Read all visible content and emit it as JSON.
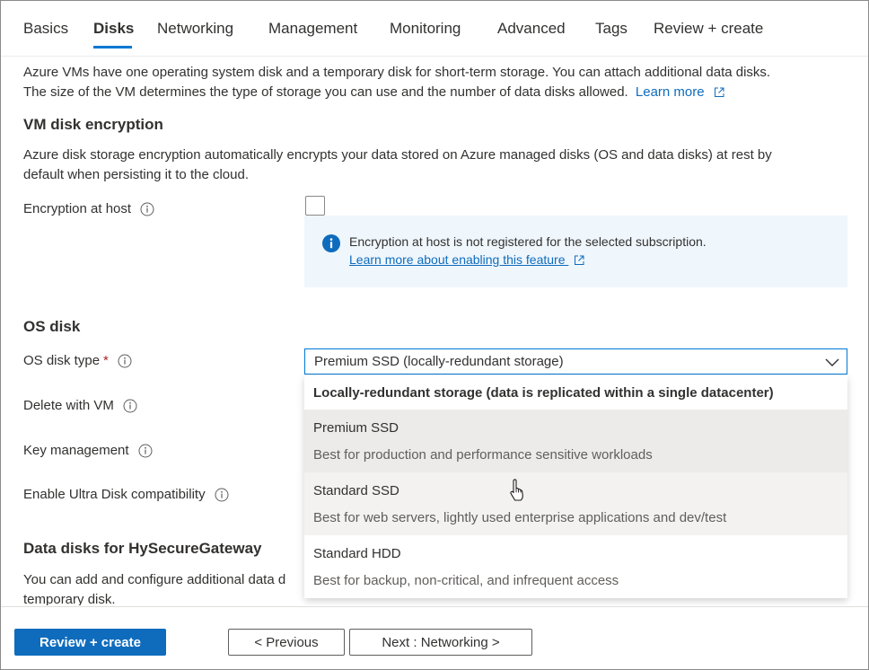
{
  "tabs": [
    {
      "label": "Basics",
      "active": false
    },
    {
      "label": "Disks",
      "active": true
    },
    {
      "label": "Networking",
      "active": false
    },
    {
      "label": "Management",
      "active": false
    },
    {
      "label": "Monitoring",
      "active": false
    },
    {
      "label": "Advanced",
      "active": false
    },
    {
      "label": "Tags",
      "active": false
    },
    {
      "label": "Review + create",
      "active": false
    }
  ],
  "intro": {
    "line1": "Azure VMs have one operating system disk and a temporary disk for short-term storage. You can attach additional data disks.",
    "line2": "The size of the VM determines the type of storage you can use and the number of data disks allowed.",
    "learn_more": "Learn more"
  },
  "encryption": {
    "heading": "VM disk encryption",
    "desc_line1": "Azure disk storage encryption automatically encrypts your data stored on Azure managed disks (OS and data disks) at rest by",
    "desc_line2": "default when persisting it to the cloud.",
    "host_label": "Encryption at host",
    "host_checked": false,
    "notice_text": "Encryption at host is not registered for the selected subscription.",
    "notice_link": "Learn more about enabling this feature"
  },
  "os_disk": {
    "heading": "OS disk",
    "type_label": "OS disk type",
    "required_mark": "*",
    "type_value": "Premium SSD (locally-redundant storage)",
    "delete_label": "Delete with VM",
    "key_label": "Key management",
    "ultra_label": "Enable Ultra Disk compatibility"
  },
  "dropdown": {
    "group_header": "Locally-redundant storage (data is replicated within a single datacenter)",
    "options": [
      {
        "title": "Premium SSD",
        "desc": "Best for production and performance sensitive workloads",
        "state": "selected"
      },
      {
        "title": "Standard SSD",
        "desc": "Best for web servers, lightly used enterprise applications and dev/test",
        "state": "hover"
      },
      {
        "title": "Standard HDD",
        "desc": "Best for backup, non-critical, and infrequent access",
        "state": "none"
      }
    ]
  },
  "data_disks": {
    "heading": "Data disks for HySecureGateway",
    "desc_line1": "You can add and configure additional data d",
    "desc_line2": "temporary disk."
  },
  "footer": {
    "review_create": "Review + create",
    "previous": "< Previous",
    "next": "Next : Networking >"
  },
  "colors": {
    "accent": "#0078d4",
    "primary_button": "#0f6cbd",
    "link": "#0f6cbd",
    "info_background": "#eff6fc",
    "required": "#a4262c"
  },
  "icons": {
    "info": "info-circle-icon",
    "external_link": "open-in-new-icon",
    "chevron": "chevron-down-icon",
    "notice": "info-filled-icon",
    "cursor": "hand-pointer-icon"
  }
}
